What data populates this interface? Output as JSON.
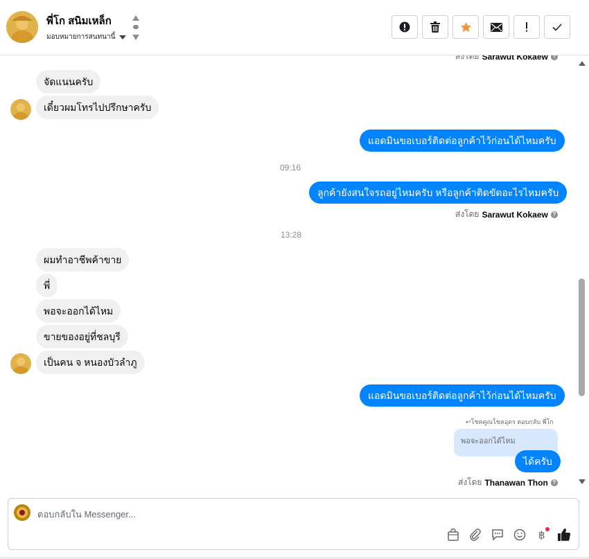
{
  "header": {
    "contact_name": "พี่โก สนิมเหล็ก",
    "assign_label": "มอบหมายการสนทนานี้",
    "toolbar": [
      {
        "name": "spam-button",
        "icon": "alert-circle-icon"
      },
      {
        "name": "delete-button",
        "icon": "trash-icon"
      },
      {
        "name": "star-button",
        "icon": "star-icon"
      },
      {
        "name": "mark-unread-button",
        "icon": "envelope-icon"
      },
      {
        "name": "follow-up-button",
        "icon": "exclamation-icon"
      },
      {
        "name": "done-button",
        "icon": "check-icon"
      }
    ]
  },
  "conversation": {
    "top_sent_by_prefix": "ส่งโดย",
    "top_sent_by_name": "Sarawut Kokaew",
    "msg1": "จัดแนนครับ",
    "msg2": "เดี๋ยวผมโทรไปปรึกษาครับ",
    "out1": "แอดมินขอเบอร์ติดต่อลูกค้าไว้ก่อนได้ไหมครับ",
    "time1": "09:16",
    "out2": "ลูกค้ายังสนใจรถอยู่ไหมครับ หรือลูกค้าติดขัดอะไรไหมครับ",
    "sent_by_prefix": "ส่งโดย",
    "sent_by_name_1": "Sarawut Kokaew",
    "time2": "13:28",
    "msg3": "ผมทำอาชีพค้าขาย",
    "msg4": "พี่",
    "msg5": "พอจะออกได้ไหม",
    "msg6": "ขายของอยู่ที่ชลบุรี",
    "msg7": "เป็นคน จ หนองบัวลำภู",
    "out3": "แอดมินขอเบอร์ติดต่อลูกค้าไว้ก่อนได้ไหมครับ",
    "reply_note": "โชคคูณโชคอุดร ตอบกลับ พี่โก",
    "quoted": "พอจะออกได้ไหม",
    "out4": "ได้ครับ",
    "sent_by_name_2": "Thanawan Thon"
  },
  "composer": {
    "placeholder": "ตอบกลับใน Messenger...",
    "icons": [
      "shopping-bag-icon",
      "paperclip-icon",
      "saved-replies-icon",
      "emoji-icon",
      "baht-payment-icon",
      "thumbs-up-icon"
    ]
  },
  "colors": {
    "outgoing": "#0084ff",
    "incoming": "#f0f0f0",
    "star": "#f7923b"
  }
}
